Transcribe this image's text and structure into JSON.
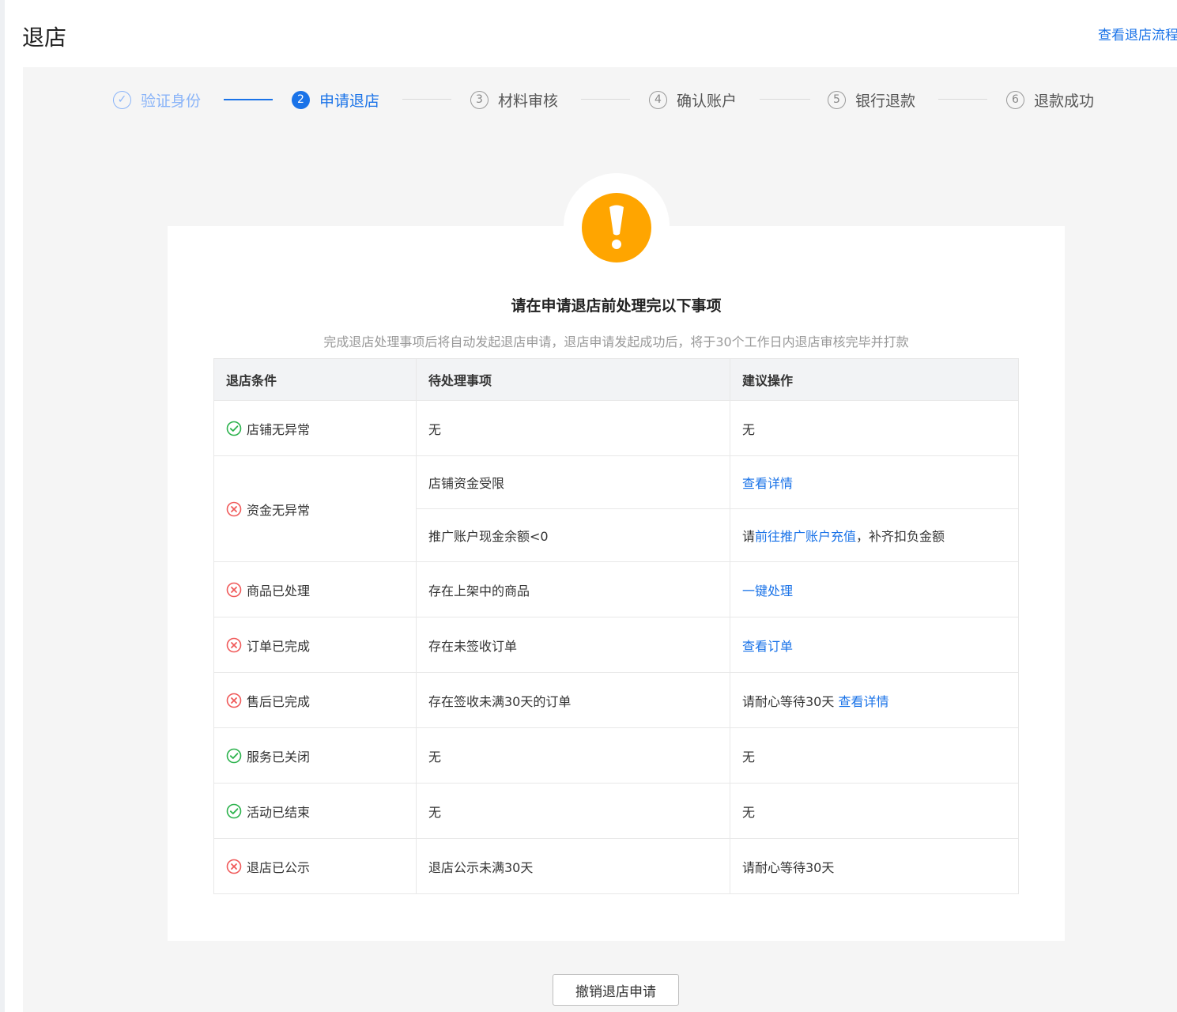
{
  "header": {
    "title": "退店",
    "flow_link": "查看退店流程"
  },
  "steps": [
    {
      "num": "✓",
      "label": "验证身份",
      "state": "done"
    },
    {
      "num": "2",
      "label": "申请退店",
      "state": "active"
    },
    {
      "num": "3",
      "label": "材料审核",
      "state": "todo"
    },
    {
      "num": "4",
      "label": "确认账户",
      "state": "todo"
    },
    {
      "num": "5",
      "label": "银行退款",
      "state": "todo"
    },
    {
      "num": "6",
      "label": "退款成功",
      "state": "todo"
    }
  ],
  "notice": {
    "title": "请在申请退店前处理完以下事项",
    "subtitle": "完成退店处理事项后将自动发起退店申请，退店申请发起成功后，将于30个工作日内退店审核完毕并打款"
  },
  "table": {
    "headers": [
      "退店条件",
      "待处理事项",
      "建议操作"
    ],
    "rows": [
      {
        "condition": "店铺无异常",
        "status": "ok",
        "items": [
          {
            "pending": "无",
            "action_pre": "无"
          }
        ]
      },
      {
        "condition": "资金无异常",
        "status": "fail",
        "items": [
          {
            "pending": "店铺资金受限",
            "action_link": "查看详情"
          },
          {
            "pending": "推广账户现金余额<0",
            "action_pre": "请",
            "action_link": "前往推广账户充值",
            "action_post": "，补齐扣负金额"
          }
        ]
      },
      {
        "condition": "商品已处理",
        "status": "fail",
        "items": [
          {
            "pending": "存在上架中的商品",
            "action_link": "一键处理"
          }
        ]
      },
      {
        "condition": "订单已完成",
        "status": "fail",
        "items": [
          {
            "pending": "存在未签收订单",
            "action_link": "查看订单"
          }
        ]
      },
      {
        "condition": "售后已完成",
        "status": "fail",
        "items": [
          {
            "pending": "存在签收未满30天的订单",
            "action_pre": "请耐心等待30天 ",
            "action_link": "查看详情"
          }
        ]
      },
      {
        "condition": "服务已关闭",
        "status": "ok",
        "items": [
          {
            "pending": "无",
            "action_pre": "无"
          }
        ]
      },
      {
        "condition": "活动已结束",
        "status": "ok",
        "items": [
          {
            "pending": "无",
            "action_pre": "无"
          }
        ]
      },
      {
        "condition": "退店已公示",
        "status": "fail",
        "items": [
          {
            "pending": "退店公示未满30天",
            "action_pre": "请耐心等待30天"
          }
        ]
      }
    ]
  },
  "footer": {
    "cancel_label": "撤销退店申请"
  },
  "colors": {
    "primary": "#1a73e8",
    "success": "#2bb24c",
    "error": "#f05a5a",
    "warning": "#ffa500"
  }
}
